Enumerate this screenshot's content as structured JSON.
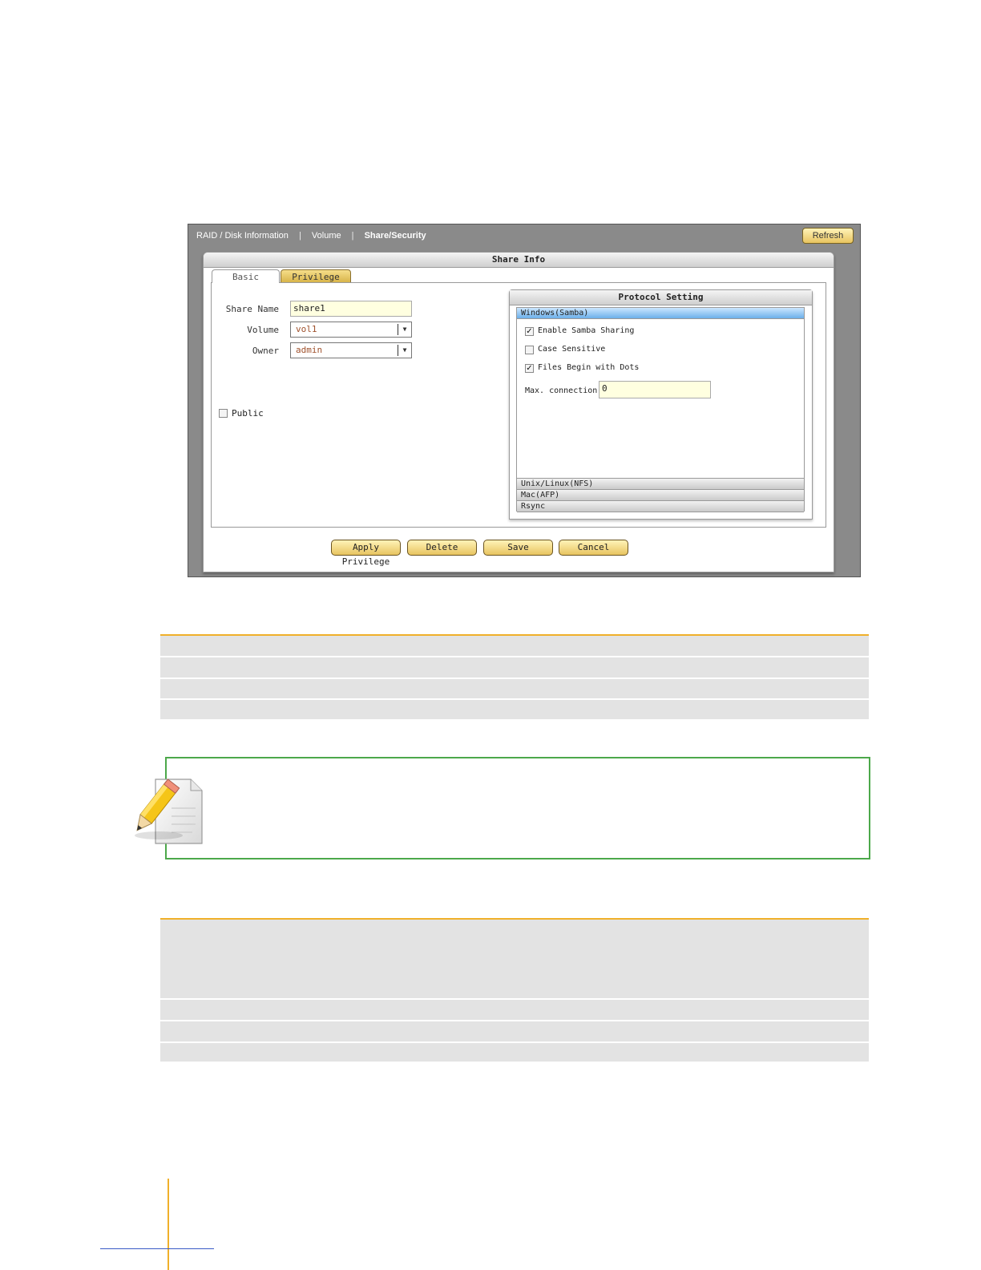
{
  "nav": {
    "items": [
      "RAID / Disk Information",
      "Volume",
      "Share/Security"
    ],
    "refresh_label": "Refresh"
  },
  "share_info": {
    "title": "Share Info",
    "tabs": [
      "Basic",
      "Privilege"
    ],
    "share_name_label": "Share Name",
    "share_name_value": "share1",
    "volume_label": "Volume",
    "volume_value": "vol1",
    "owner_label": "Owner",
    "owner_value": "admin",
    "public_label": "Public",
    "public_checked": false
  },
  "protocol": {
    "title": "Protocol Setting",
    "open_section": "Windows(Samba)",
    "options": [
      {
        "label": "Enable Samba Sharing",
        "checked": true
      },
      {
        "label": "Case Sensitive",
        "checked": false
      },
      {
        "label": "Files Begin with Dots",
        "checked": true
      }
    ],
    "max_connection_label": "Max. connection",
    "max_connection_value": "0",
    "closed_sections": [
      "Unix/Linux(NFS)",
      "Mac(AFP)",
      "Rsync"
    ]
  },
  "buttons": {
    "apply_privilege": "Apply Privilege",
    "delete": "Delete",
    "save": "Save",
    "cancel": "Cancel"
  },
  "colors": {
    "table_rule": "#f0b02a",
    "note_border": "#4ca84a",
    "button_gold": "#e8c460"
  }
}
